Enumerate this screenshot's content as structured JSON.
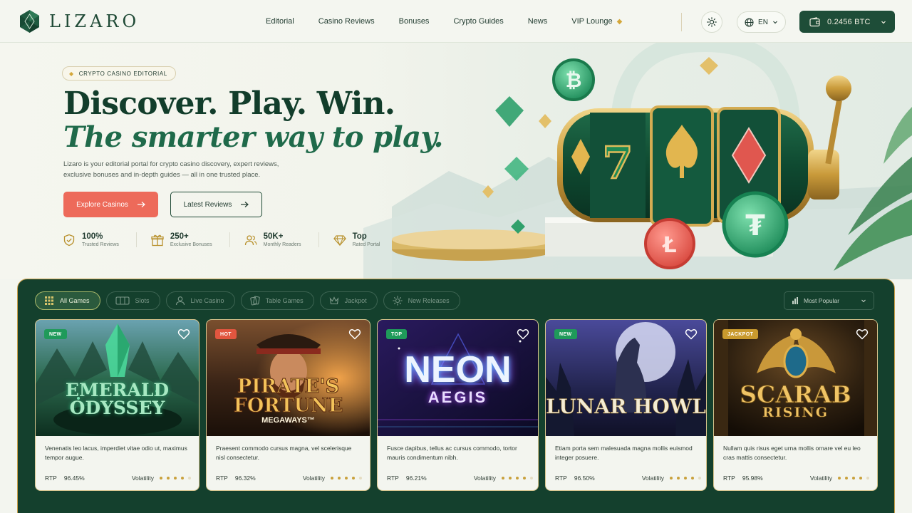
{
  "brand": {
    "name": "LIZARO"
  },
  "nav": {
    "links": [
      "Editorial",
      "Casino Reviews",
      "Bonuses",
      "Crypto Guides",
      "News",
      "VIP Lounge"
    ],
    "language": "EN",
    "wallet": "0.2456 BTC"
  },
  "hero": {
    "badge": "CRYPTO CASINO EDITORIAL",
    "title": "Discover. Play. Win.",
    "subtitle": "The smarter way to play.",
    "description": "Lizaro is your editorial portal for crypto casino discovery, expert reviews, exclusive bonuses and in-depth guides — all in one trusted place.",
    "primary_button": "Explore Casinos",
    "secondary_button": "Latest Reviews",
    "stats": [
      {
        "value": "100%",
        "label": "Trusted Reviews",
        "icon": "shield-check-icon"
      },
      {
        "value": "250+",
        "label": "Exclusive Bonuses",
        "icon": "gift-icon"
      },
      {
        "value": "50K+",
        "label": "Monthly Readers",
        "icon": "users-icon"
      },
      {
        "value": "Top",
        "label": "Rated Portal",
        "icon": "diamond-icon"
      }
    ]
  },
  "games": {
    "filters": [
      {
        "label": "All Games",
        "icon": "grid-icon",
        "active": true
      },
      {
        "label": "Slots",
        "icon": "slot-icon",
        "active": false
      },
      {
        "label": "Live Casino",
        "icon": "dealer-icon",
        "active": false
      },
      {
        "label": "Table Games",
        "icon": "cards-icon",
        "active": false
      },
      {
        "label": "Jackpot",
        "icon": "crown-icon",
        "active": false
      },
      {
        "label": "New Releases",
        "icon": "sparkle-icon",
        "active": false
      }
    ],
    "sort": "Most Popular",
    "cards": [
      {
        "tag": "NEW",
        "tag_color": "#1f9a5a",
        "title": "EMERALD",
        "title2": "ODYSSEY",
        "desc": "Venenatis leo lacus, imperdiet vitae odio ut, maximus tempor augue.",
        "rtp_label": "RTP",
        "rtp": "96.45%",
        "vol_label": "Volatility",
        "volatility": 4
      },
      {
        "tag": "HOT",
        "tag_color": "#e2563f",
        "title": "PIRATE'S",
        "title2": "FORTUNE",
        "title3": "MEGAWAYS™",
        "desc": "Praesent commodo cursus magna, vel scelerisque nisl consectetur.",
        "rtp_label": "RTP",
        "rtp": "96.32%",
        "vol_label": "Volatility",
        "volatility": 4
      },
      {
        "tag": "TOP",
        "tag_color": "#1f9a5a",
        "title": "NEON",
        "title2": "AEGIS",
        "desc": "Fusce dapibus, tellus ac cursus commodo, tortor mauris condimentum nibh.",
        "rtp_label": "RTP",
        "rtp": "96.21%",
        "vol_label": "Volatility",
        "volatility": 4
      },
      {
        "tag": "NEW",
        "tag_color": "#1f9a5a",
        "title": "LUNAR HOWL",
        "desc": "Etiam porta sem malesuada magna mollis euismod integer posuere.",
        "rtp_label": "RTP",
        "rtp": "96.50%",
        "vol_label": "Volatility",
        "volatility": 4
      },
      {
        "tag": "JACKPOT",
        "tag_color": "#c99a2e",
        "title": "SCARAB",
        "title2": "RISING",
        "desc": "Nullam quis risus eget urna mollis ornare vel eu leo cras mattis consectetur.",
        "rtp_label": "RTP",
        "rtp": "95.98%",
        "vol_label": "Volatility",
        "volatility": 4
      }
    ]
  }
}
